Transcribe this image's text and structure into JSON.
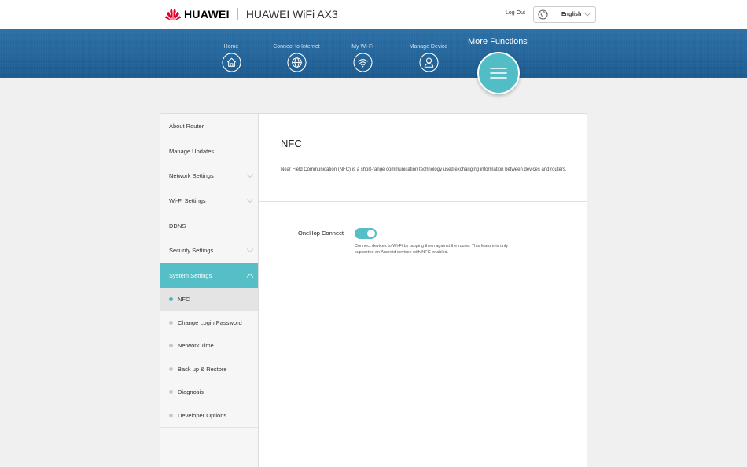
{
  "header": {
    "brand": "HUAWEI",
    "product": "HUAWEI WiFi AX3",
    "logout_label": "Log Out",
    "language": "English"
  },
  "nav": {
    "items": [
      {
        "label": "Home",
        "icon": "home-icon"
      },
      {
        "label": "Connect to Internet",
        "icon": "globe-icon"
      },
      {
        "label": "My Wi-Fi",
        "icon": "wifi-icon"
      },
      {
        "label": "Manage Device",
        "icon": "user-icon"
      }
    ],
    "more": {
      "label": "More Functions",
      "icon": "menu-icon"
    }
  },
  "sidebar": {
    "items": [
      {
        "label": "About Router",
        "expandable": false
      },
      {
        "label": "Manage Updates",
        "expandable": false
      },
      {
        "label": "Network Settings",
        "expandable": true
      },
      {
        "label": "Wi-Fi Settings",
        "expandable": true
      },
      {
        "label": "DDNS",
        "expandable": false
      },
      {
        "label": "Security Settings",
        "expandable": true
      },
      {
        "label": "System Settings",
        "expandable": true,
        "active": true
      }
    ],
    "subitems": [
      {
        "label": "NFC",
        "selected": true
      },
      {
        "label": "Change Login Password"
      },
      {
        "label": "Network Time"
      },
      {
        "label": "Back up & Restore"
      },
      {
        "label": "Diagnosis"
      },
      {
        "label": "Developer Options"
      }
    ]
  },
  "main": {
    "title": "NFC",
    "description": "Near Field Communication (NFC) is a short-range communication technology used exchanging information between devices and routers.",
    "setting": {
      "label": "OneHop Connect",
      "enabled": true,
      "help": "Connect devices to Wi-Fi by tapping them against the router. This feature is only supported on Android devices with NFC enabled."
    }
  },
  "colors": {
    "accent": "#55bec6",
    "nav_bg": "#1f5f95",
    "brand_red": "#e4002b"
  }
}
